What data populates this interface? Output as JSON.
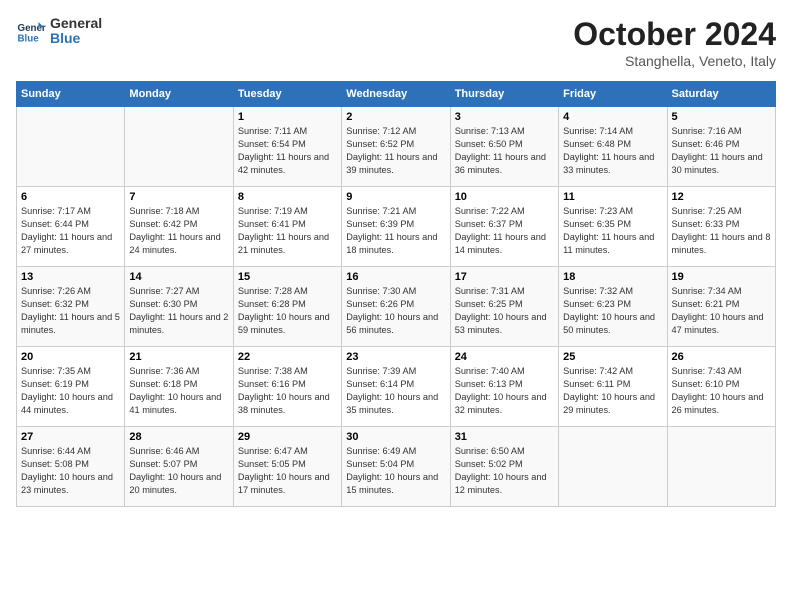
{
  "header": {
    "logo": {
      "line1": "General",
      "line2": "Blue"
    },
    "month": "October 2024",
    "location": "Stanghella, Veneto, Italy"
  },
  "weekdays": [
    "Sunday",
    "Monday",
    "Tuesday",
    "Wednesday",
    "Thursday",
    "Friday",
    "Saturday"
  ],
  "weeks": [
    [
      {
        "day": "",
        "details": ""
      },
      {
        "day": "",
        "details": ""
      },
      {
        "day": "1",
        "details": "Sunrise: 7:11 AM\nSunset: 6:54 PM\nDaylight: 11 hours and 42 minutes."
      },
      {
        "day": "2",
        "details": "Sunrise: 7:12 AM\nSunset: 6:52 PM\nDaylight: 11 hours and 39 minutes."
      },
      {
        "day": "3",
        "details": "Sunrise: 7:13 AM\nSunset: 6:50 PM\nDaylight: 11 hours and 36 minutes."
      },
      {
        "day": "4",
        "details": "Sunrise: 7:14 AM\nSunset: 6:48 PM\nDaylight: 11 hours and 33 minutes."
      },
      {
        "day": "5",
        "details": "Sunrise: 7:16 AM\nSunset: 6:46 PM\nDaylight: 11 hours and 30 minutes."
      }
    ],
    [
      {
        "day": "6",
        "details": "Sunrise: 7:17 AM\nSunset: 6:44 PM\nDaylight: 11 hours and 27 minutes."
      },
      {
        "day": "7",
        "details": "Sunrise: 7:18 AM\nSunset: 6:42 PM\nDaylight: 11 hours and 24 minutes."
      },
      {
        "day": "8",
        "details": "Sunrise: 7:19 AM\nSunset: 6:41 PM\nDaylight: 11 hours and 21 minutes."
      },
      {
        "day": "9",
        "details": "Sunrise: 7:21 AM\nSunset: 6:39 PM\nDaylight: 11 hours and 18 minutes."
      },
      {
        "day": "10",
        "details": "Sunrise: 7:22 AM\nSunset: 6:37 PM\nDaylight: 11 hours and 14 minutes."
      },
      {
        "day": "11",
        "details": "Sunrise: 7:23 AM\nSunset: 6:35 PM\nDaylight: 11 hours and 11 minutes."
      },
      {
        "day": "12",
        "details": "Sunrise: 7:25 AM\nSunset: 6:33 PM\nDaylight: 11 hours and 8 minutes."
      }
    ],
    [
      {
        "day": "13",
        "details": "Sunrise: 7:26 AM\nSunset: 6:32 PM\nDaylight: 11 hours and 5 minutes."
      },
      {
        "day": "14",
        "details": "Sunrise: 7:27 AM\nSunset: 6:30 PM\nDaylight: 11 hours and 2 minutes."
      },
      {
        "day": "15",
        "details": "Sunrise: 7:28 AM\nSunset: 6:28 PM\nDaylight: 10 hours and 59 minutes."
      },
      {
        "day": "16",
        "details": "Sunrise: 7:30 AM\nSunset: 6:26 PM\nDaylight: 10 hours and 56 minutes."
      },
      {
        "day": "17",
        "details": "Sunrise: 7:31 AM\nSunset: 6:25 PM\nDaylight: 10 hours and 53 minutes."
      },
      {
        "day": "18",
        "details": "Sunrise: 7:32 AM\nSunset: 6:23 PM\nDaylight: 10 hours and 50 minutes."
      },
      {
        "day": "19",
        "details": "Sunrise: 7:34 AM\nSunset: 6:21 PM\nDaylight: 10 hours and 47 minutes."
      }
    ],
    [
      {
        "day": "20",
        "details": "Sunrise: 7:35 AM\nSunset: 6:19 PM\nDaylight: 10 hours and 44 minutes."
      },
      {
        "day": "21",
        "details": "Sunrise: 7:36 AM\nSunset: 6:18 PM\nDaylight: 10 hours and 41 minutes."
      },
      {
        "day": "22",
        "details": "Sunrise: 7:38 AM\nSunset: 6:16 PM\nDaylight: 10 hours and 38 minutes."
      },
      {
        "day": "23",
        "details": "Sunrise: 7:39 AM\nSunset: 6:14 PM\nDaylight: 10 hours and 35 minutes."
      },
      {
        "day": "24",
        "details": "Sunrise: 7:40 AM\nSunset: 6:13 PM\nDaylight: 10 hours and 32 minutes."
      },
      {
        "day": "25",
        "details": "Sunrise: 7:42 AM\nSunset: 6:11 PM\nDaylight: 10 hours and 29 minutes."
      },
      {
        "day": "26",
        "details": "Sunrise: 7:43 AM\nSunset: 6:10 PM\nDaylight: 10 hours and 26 minutes."
      }
    ],
    [
      {
        "day": "27",
        "details": "Sunrise: 6:44 AM\nSunset: 5:08 PM\nDaylight: 10 hours and 23 minutes."
      },
      {
        "day": "28",
        "details": "Sunrise: 6:46 AM\nSunset: 5:07 PM\nDaylight: 10 hours and 20 minutes."
      },
      {
        "day": "29",
        "details": "Sunrise: 6:47 AM\nSunset: 5:05 PM\nDaylight: 10 hours and 17 minutes."
      },
      {
        "day": "30",
        "details": "Sunrise: 6:49 AM\nSunset: 5:04 PM\nDaylight: 10 hours and 15 minutes."
      },
      {
        "day": "31",
        "details": "Sunrise: 6:50 AM\nSunset: 5:02 PM\nDaylight: 10 hours and 12 minutes."
      },
      {
        "day": "",
        "details": ""
      },
      {
        "day": "",
        "details": ""
      }
    ]
  ]
}
